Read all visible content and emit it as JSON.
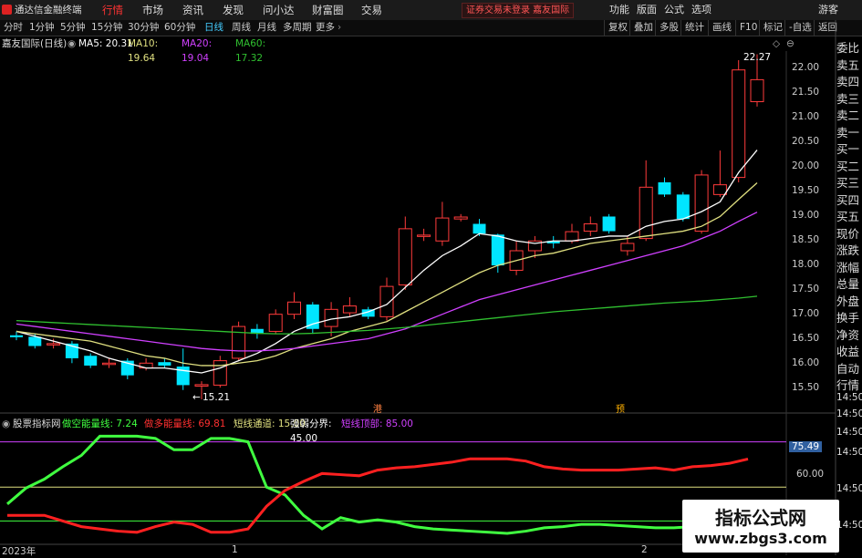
{
  "menubar": {
    "app_title": "通达信金融终端",
    "menus": [
      "行情",
      "市场",
      "资讯",
      "发现",
      "问小达",
      "财富圈",
      "交易"
    ],
    "active_menu": "行情",
    "notice": "证券交易未登录   嘉友国际",
    "right_items": [
      "功能",
      "版面",
      "公式",
      "选项",
      "游客"
    ]
  },
  "toolbar": {
    "periods": [
      "分时",
      "1分钟",
      "5分钟",
      "15分钟",
      "30分钟",
      "60分钟",
      "日线",
      "周线",
      "月线",
      "多周期",
      "更多"
    ],
    "active_period": "日线",
    "tools": [
      "复权",
      "叠加",
      "多股",
      "统计",
      "画线",
      "F10",
      "标记",
      "-自选",
      "返回"
    ]
  },
  "legend": {
    "stock_name": "嘉友国际(日线)",
    "ma5": "MA5: 20.31",
    "ma10": "MA10: 19.64",
    "ma20": "MA20: 19.04",
    "ma60": "MA60: 17.32"
  },
  "indicator": {
    "name": "股票指标网",
    "long_energy": "做空能量线: 7.24",
    "short_energy": "做多能量线: 69.81",
    "channel": "短线通道: 15.00",
    "boundary": "强弱分界: 45.00",
    "top": "短线顶部: 85.00",
    "current_value": "75.49",
    "axis_value": "60.00"
  },
  "sidebar": {
    "items": [
      "委比",
      "卖五",
      "卖四",
      "卖三",
      "卖二",
      "卖一",
      "买一",
      "买二",
      "买三",
      "买四",
      "买五",
      "现价",
      "涨跌",
      "涨幅",
      "总量",
      "外盘",
      "换手",
      "净资",
      "收益",
      "自动",
      "行情"
    ]
  },
  "price_axis": {
    "ticks": [
      "22.00",
      "21.50",
      "21.00",
      "20.50",
      "20.00",
      "19.50",
      "19.00",
      "18.50",
      "18.00",
      "17.50",
      "17.00",
      "16.50",
      "16.00",
      "15.50"
    ],
    "high_marker": "22.27",
    "low_marker": "15.21",
    "time_labels": [
      "14:50",
      "14:50",
      "14:50",
      "14:50",
      "14:50",
      "14:50"
    ]
  },
  "date_axis": {
    "labels": [
      "2023年",
      "1",
      "2"
    ]
  },
  "markers": {
    "marker1": "港",
    "marker2": "预"
  },
  "watermark": {
    "title": "指标公式网",
    "url": "www.zbgs3.com"
  },
  "colors": {
    "up": "#ff3b3b",
    "down": "#00e5ff",
    "ma5": "#ffffff",
    "ma10": "#e0e080",
    "ma20": "#d040ff",
    "ma60": "#30c030",
    "long_line": "#40ff40",
    "short_line": "#ff2020"
  },
  "chart_data": [
    {
      "type": "candlestick",
      "title": "嘉友国际(日线)",
      "y_range": [
        15.3,
        22.4
      ],
      "candles": [
        {
          "o": 16.52,
          "c": 16.48,
          "h": 16.6,
          "l": 16.42
        },
        {
          "o": 16.49,
          "c": 16.3,
          "h": 16.55,
          "l": 16.25
        },
        {
          "o": 16.33,
          "c": 16.35,
          "h": 16.45,
          "l": 16.25
        },
        {
          "o": 16.35,
          "c": 16.05,
          "h": 16.4,
          "l": 15.95
        },
        {
          "o": 16.1,
          "c": 15.9,
          "h": 16.15,
          "l": 15.85
        },
        {
          "o": 15.95,
          "c": 15.95,
          "h": 16.05,
          "l": 15.85
        },
        {
          "o": 16.0,
          "c": 15.7,
          "h": 16.05,
          "l": 15.62
        },
        {
          "o": 15.85,
          "c": 15.95,
          "h": 16.05,
          "l": 15.8
        },
        {
          "o": 15.97,
          "c": 15.9,
          "h": 16.05,
          "l": 15.85
        },
        {
          "o": 15.88,
          "c": 15.5,
          "h": 16.25,
          "l": 15.4
        },
        {
          "o": 15.48,
          "c": 15.51,
          "h": 15.58,
          "l": 15.21
        },
        {
          "o": 15.5,
          "c": 16.0,
          "h": 16.1,
          "l": 15.45
        },
        {
          "o": 16.05,
          "c": 16.7,
          "h": 16.8,
          "l": 16.0
        },
        {
          "o": 16.65,
          "c": 16.55,
          "h": 16.75,
          "l": 16.45
        },
        {
          "o": 16.6,
          "c": 16.95,
          "h": 17.05,
          "l": 16.55
        },
        {
          "o": 16.95,
          "c": 17.2,
          "h": 17.4,
          "l": 16.85
        },
        {
          "o": 17.15,
          "c": 16.65,
          "h": 17.2,
          "l": 16.55
        },
        {
          "o": 16.7,
          "c": 17.05,
          "h": 17.2,
          "l": 16.5
        },
        {
          "o": 16.98,
          "c": 17.12,
          "h": 17.3,
          "l": 16.9
        },
        {
          "o": 17.05,
          "c": 16.9,
          "h": 17.1,
          "l": 16.85
        },
        {
          "o": 16.9,
          "c": 17.52,
          "h": 17.7,
          "l": 16.82
        },
        {
          "o": 17.55,
          "c": 18.7,
          "h": 18.95,
          "l": 17.45
        },
        {
          "o": 18.55,
          "c": 18.57,
          "h": 18.7,
          "l": 18.45
        },
        {
          "o": 18.45,
          "c": 18.92,
          "h": 19.25,
          "l": 18.35
        },
        {
          "o": 18.9,
          "c": 18.94,
          "h": 19.0,
          "l": 18.85
        },
        {
          "o": 18.8,
          "c": 18.6,
          "h": 18.9,
          "l": 18.55
        },
        {
          "o": 18.58,
          "c": 17.95,
          "h": 18.6,
          "l": 17.8
        },
        {
          "o": 17.85,
          "c": 18.25,
          "h": 18.45,
          "l": 17.75
        },
        {
          "o": 18.25,
          "c": 18.45,
          "h": 18.55,
          "l": 18.1
        },
        {
          "o": 18.45,
          "c": 18.4,
          "h": 18.55,
          "l": 18.3
        },
        {
          "o": 18.45,
          "c": 18.64,
          "h": 18.8,
          "l": 18.4
        },
        {
          "o": 18.65,
          "c": 18.8,
          "h": 18.95,
          "l": 18.55
        },
        {
          "o": 18.95,
          "c": 18.65,
          "h": 19.0,
          "l": 18.6
        },
        {
          "o": 18.25,
          "c": 18.4,
          "h": 18.55,
          "l": 18.15
        },
        {
          "o": 18.5,
          "c": 19.55,
          "h": 20.1,
          "l": 18.45
        },
        {
          "o": 19.65,
          "c": 19.4,
          "h": 19.75,
          "l": 19.35
        },
        {
          "o": 19.4,
          "c": 18.9,
          "h": 19.45,
          "l": 18.85
        },
        {
          "o": 18.65,
          "c": 19.8,
          "h": 19.9,
          "l": 18.6
        },
        {
          "o": 19.4,
          "c": 19.6,
          "h": 20.3,
          "l": 19.35
        },
        {
          "o": 19.75,
          "c": 21.95,
          "h": 22.15,
          "l": 19.65
        },
        {
          "o": 21.3,
          "c": 21.75,
          "h": 22.27,
          "l": 21.2
        }
      ],
      "ma_series": [
        {
          "name": "MA5",
          "values": [
            16.6,
            16.5,
            16.4,
            16.3,
            16.2,
            16.05,
            15.95,
            15.85,
            15.85,
            15.8,
            15.75,
            15.85,
            16.0,
            16.15,
            16.35,
            16.6,
            16.75,
            16.85,
            16.9,
            17.0,
            17.15,
            17.5,
            17.85,
            18.15,
            18.35,
            18.6,
            18.55,
            18.45,
            18.4,
            18.45,
            18.45,
            18.5,
            18.55,
            18.55,
            18.75,
            18.85,
            18.9,
            19.05,
            19.25,
            19.85,
            20.31
          ]
        },
        {
          "name": "MA10",
          "values": [
            16.6,
            16.55,
            16.5,
            16.45,
            16.4,
            16.3,
            16.2,
            16.1,
            16.05,
            15.95,
            15.9,
            15.9,
            15.95,
            16.0,
            16.1,
            16.25,
            16.35,
            16.45,
            16.6,
            16.7,
            16.8,
            17.0,
            17.2,
            17.4,
            17.6,
            17.8,
            17.95,
            18.05,
            18.15,
            18.2,
            18.3,
            18.4,
            18.45,
            18.5,
            18.55,
            18.6,
            18.65,
            18.75,
            18.95,
            19.3,
            19.64
          ]
        },
        {
          "name": "MA20",
          "values": [
            16.75,
            16.7,
            16.65,
            16.6,
            16.55,
            16.5,
            16.45,
            16.4,
            16.35,
            16.3,
            16.25,
            16.22,
            16.2,
            16.2,
            16.22,
            16.25,
            16.3,
            16.35,
            16.4,
            16.45,
            16.55,
            16.65,
            16.8,
            16.95,
            17.1,
            17.25,
            17.35,
            17.45,
            17.55,
            17.65,
            17.75,
            17.85,
            17.95,
            18.05,
            18.15,
            18.25,
            18.35,
            18.5,
            18.65,
            18.85,
            19.04
          ]
        },
        {
          "name": "MA60",
          "values": [
            16.82,
            16.8,
            16.78,
            16.76,
            16.74,
            16.72,
            16.7,
            16.68,
            16.66,
            16.64,
            16.62,
            16.6,
            16.58,
            16.56,
            16.55,
            16.55,
            16.56,
            16.58,
            16.6,
            16.62,
            16.65,
            16.68,
            16.72,
            16.76,
            16.8,
            16.84,
            16.88,
            16.92,
            16.96,
            17.0,
            17.03,
            17.06,
            17.09,
            17.12,
            17.15,
            17.18,
            17.2,
            17.22,
            17.25,
            17.28,
            17.32
          ]
        }
      ]
    },
    {
      "type": "line",
      "title": "股票指标网",
      "y_range": [
        0,
        100
      ],
      "reference_lines": [
        85,
        45,
        15
      ],
      "series": [
        {
          "name": "做空能量线",
          "values": [
            30,
            44,
            52,
            63,
            73,
            90,
            90,
            90,
            88,
            78,
            78,
            88,
            88,
            85,
            45,
            38,
            20,
            8,
            18,
            14,
            16,
            14,
            10,
            8,
            7,
            6,
            5,
            4,
            6,
            9,
            10,
            12,
            12,
            11,
            10,
            9,
            9,
            10,
            11,
            9,
            7.24
          ]
        },
        {
          "name": "做多能量线",
          "values": [
            20,
            20,
            20,
            15,
            10,
            8,
            6,
            5,
            10,
            14,
            12,
            5,
            5,
            8,
            28,
            42,
            50,
            57,
            56,
            55,
            60,
            62,
            63,
            65,
            67,
            70,
            70,
            70,
            68,
            63,
            61,
            60,
            60,
            60,
            61,
            62,
            60,
            63,
            64,
            66,
            69.81
          ]
        }
      ]
    }
  ]
}
